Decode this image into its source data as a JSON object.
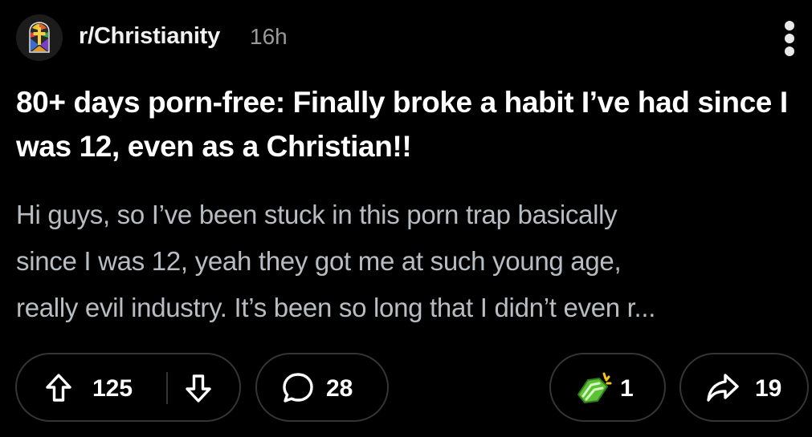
{
  "post": {
    "subreddit": "r/Christianity",
    "time_ago": "16h",
    "title": "80+ days porn-free: Finally broke a habit I’ve had since I was 12, even as a Christian!!",
    "body_lines": [
      "Hi guys, so I’ve been stuck in this porn trap basically",
      "since I was 12, yeah they got me at such young age,",
      "really evil industry. It’s been so long that I didn’t even r..."
    ]
  },
  "actions": {
    "upvotes": "125",
    "comments": "28",
    "awards": "1",
    "shares": "19"
  },
  "icons": {
    "avatar": "stained-glass-cross-icon",
    "more": "more-vertical-icon",
    "upvote": "arrow-up-icon",
    "downvote": "arrow-down-icon",
    "comment": "comment-bubble-icon",
    "award": "hands-award-icon",
    "share": "share-arrow-icon"
  },
  "colors": {
    "background": "#000000",
    "title": "#ffffff",
    "body": "#b7bdc2",
    "meta": "#9a9a9a",
    "pill_border": "#343536",
    "award_green": "#5bc236"
  }
}
